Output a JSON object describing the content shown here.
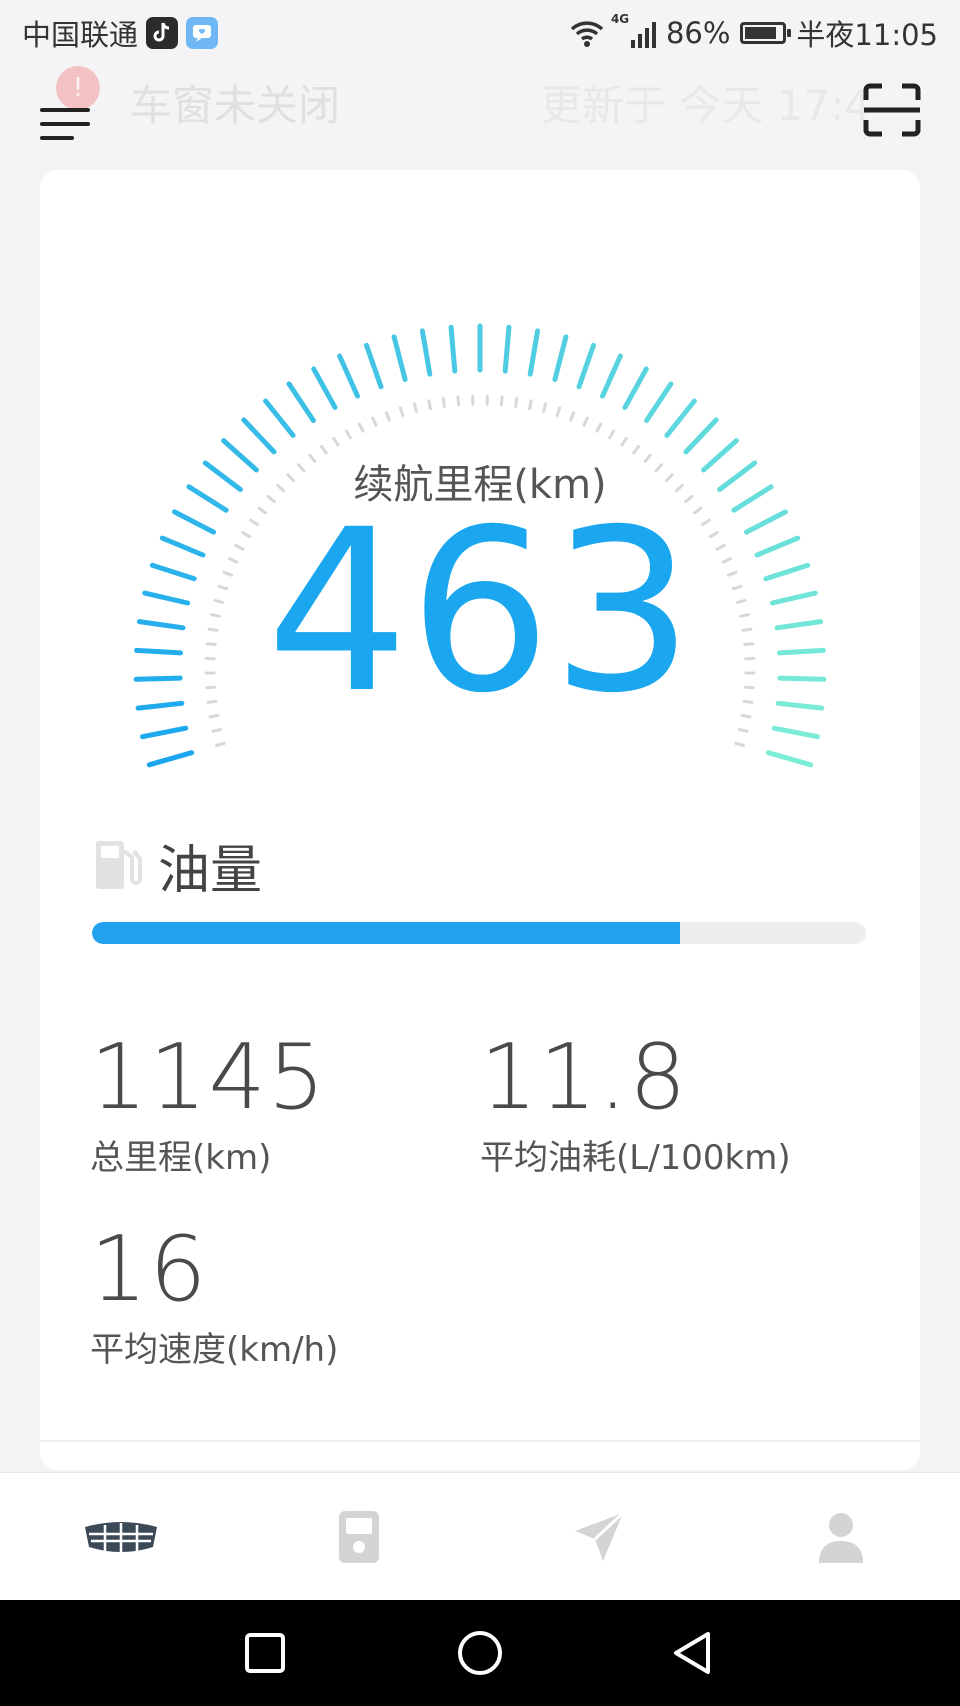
{
  "status_bar": {
    "carrier": "中国联通",
    "battery_percent": "86%",
    "time": "半夜11:05",
    "network": "4G",
    "battery_level": 0.86
  },
  "header": {
    "alert_badge": "!",
    "alert_text": "车窗未关闭",
    "updated_text": "更新于 今天 17:4"
  },
  "gauge": {
    "label": "续航里程(km)",
    "value": "463",
    "colors": {
      "start": "#1aa7ef",
      "end": "#7deed6"
    }
  },
  "fuel": {
    "title": "油量",
    "level": 0.76,
    "color": "#22a2ee"
  },
  "stats": [
    {
      "value": "1145",
      "label": "总里程(km)"
    },
    {
      "value": "11.8",
      "label": "平均油耗(L/100km)"
    },
    {
      "value": "16",
      "label": "平均速度(km/h)"
    }
  ],
  "bottom_nav": [
    {
      "icon": "car-brand-icon",
      "active": true
    },
    {
      "icon": "fuel-pump-icon",
      "active": false
    },
    {
      "icon": "navigation-arrow-icon",
      "active": false
    },
    {
      "icon": "user-profile-icon",
      "active": false
    }
  ],
  "system_nav": [
    "recent-apps-icon",
    "home-icon",
    "back-icon"
  ]
}
